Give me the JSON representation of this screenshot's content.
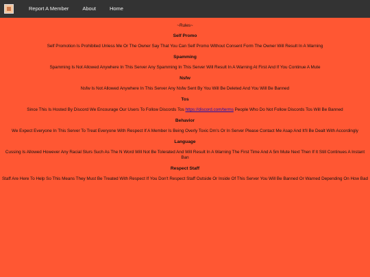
{
  "nav": {
    "links": [
      "Report A Member",
      "About",
      "Home"
    ]
  },
  "rules_heading": "~Rules~",
  "sections": [
    {
      "title": "Self Promo",
      "text": "Self Promotion Is Prohibited Unless Me Or The Owner Say That You Can Self Promo Without Consent Form The Owner Will Result In A Warning"
    },
    {
      "title": "Spamming",
      "text": "Spamming Is Not Allowed Anywhere In This Server Any Spamming In This Server Will Result In A Warning At First And If You Continue A Mute"
    },
    {
      "title": "Nsfw",
      "text": "Nsfw Is Not Allowed Anywhere In This Server Any Nsfw Sent By You Will Be Deleted And You Will Be Banned"
    },
    {
      "title": "Tos",
      "text_before": "Since This Is Hosted By Discord We Encourage Our Users To Follow Discords Tos",
      "link": "https://discord.com/terms",
      "text_after": "People Who Do Not Follow Discords Tos Will Be Banned"
    },
    {
      "title": "Behavior",
      "text": "We Expect Everyone In This Server To Treat Everyone With Respect If A Member Is Being Overly Toxic Dm's Or In Server Please Contact Me Asap And It'll Be Dealt With Accordingly"
    },
    {
      "title": "Language",
      "text": "Cussing Is Allowed However Any Racial Slurs Such As The N Word Will Not Be Tolerated And Will Result In A Warning The First Time And A 5m Mute Next Then If It Still Continues A Instant Ban"
    },
    {
      "title": "Respect Staff",
      "text": "Staff Are Here To Help So This Means They Must Be Treated With Respect If You Don't Respect Staff Outside Or Inside Of This Server You Will Be Banned Or Warned Depending On How Bad"
    }
  ],
  "colors": {
    "background": "#ff5733",
    "navbar": "#333333",
    "link": "#1a0dab"
  }
}
